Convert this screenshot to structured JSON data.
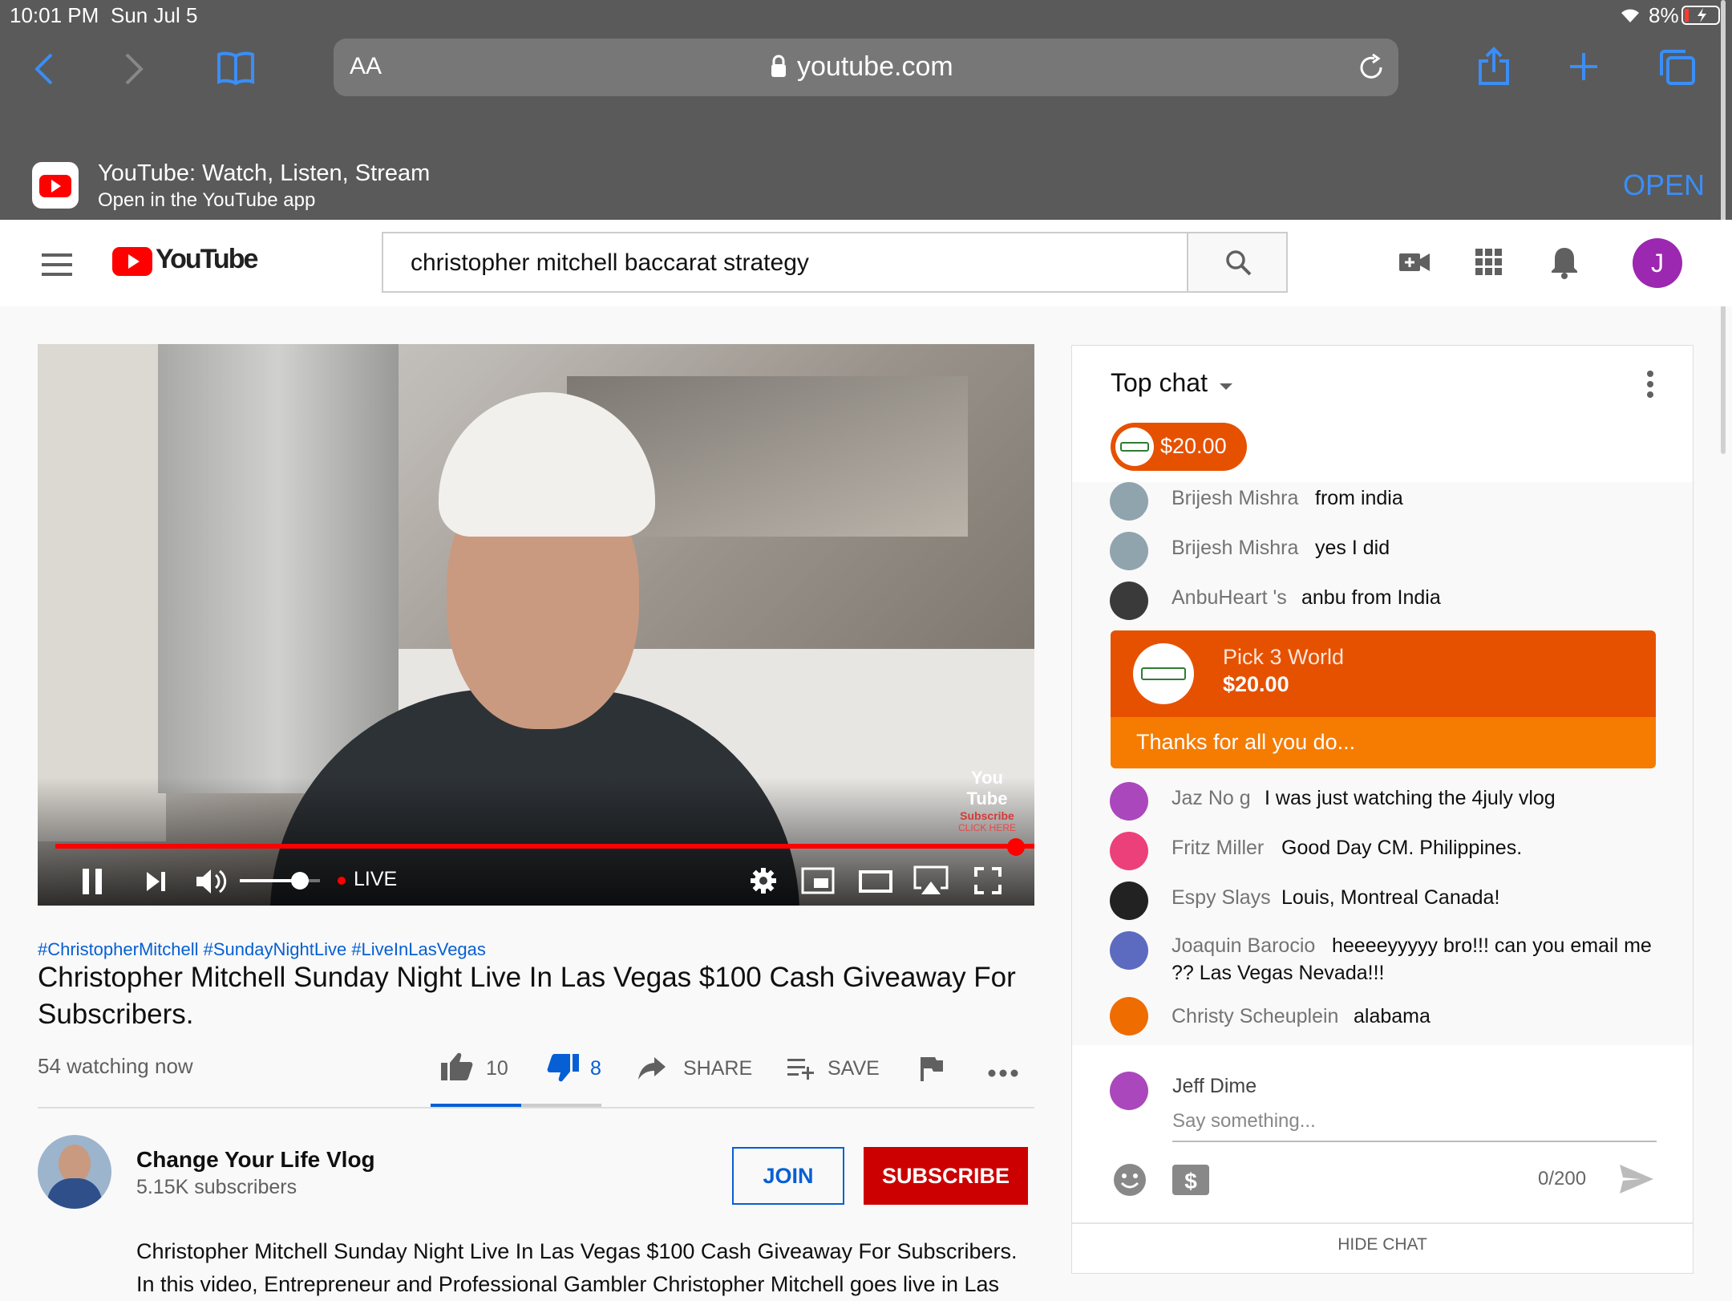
{
  "status_bar": {
    "time": "10:01 PM",
    "date": "Sun Jul 5",
    "battery": "8%"
  },
  "safari": {
    "text_size_label": "AA",
    "url": "youtube.com"
  },
  "app_banner": {
    "title": "YouTube: Watch, Listen, Stream",
    "subtitle": "Open in the YouTube app",
    "open_label": "OPEN"
  },
  "yt_header": {
    "logo_text": "YouTube",
    "search_query": "christopher mitchell baccarat strategy",
    "avatar_letter": "J"
  },
  "video": {
    "live_label": "LIVE",
    "watermark_line1": "You Tube",
    "watermark_line2": "Subscribe",
    "watermark_line3": "CLICK HERE",
    "progress": 1.0,
    "volume": 0.75
  },
  "video_info": {
    "hashtags": "#ChristopherMitchell #SundayNightLive #LiveInLasVegas",
    "title": "Christopher Mitchell Sunday Night Live In Las Vegas $100 Cash Giveaway For Subscribers.",
    "watching": "54 watching now",
    "likes": "10",
    "dislikes": "8",
    "share_label": "SHARE",
    "save_label": "SAVE"
  },
  "channel": {
    "name": "Change Your Life Vlog",
    "subscribers": "5.15K subscribers",
    "join_label": "JOIN",
    "subscribe_label": "SUBSCRIBE",
    "description": "Christopher Mitchell Sunday Night Live In Las Vegas $100 Cash Giveaway For Subscribers. In this video, Entrepreneur and Professional Gambler Christopher Mitchell goes live in Las"
  },
  "chat": {
    "header": "Top chat",
    "ticker_amount": "$20.00",
    "messages": [
      {
        "author": "Brijesh Mishra",
        "text": "from india",
        "color": "#90a4ae"
      },
      {
        "author": "Brijesh Mishra",
        "text": "yes I did",
        "color": "#90a4ae"
      },
      {
        "author": "AnbuHeart 's",
        "text": "anbu from India",
        "color": "#3a3a3a"
      }
    ],
    "superchat": {
      "author": "Pick 3 World",
      "amount": "$20.00",
      "text": "Thanks for all you do..."
    },
    "messages2": [
      {
        "author": "Jaz No g",
        "text": "I was just watching the 4july vlog",
        "color": "#ab47bc"
      },
      {
        "author": "Fritz Miller",
        "text": "Good Day CM. Philippines.",
        "color": "#ec407a"
      },
      {
        "author": "Espy Slays",
        "text": "Louis, Montreal Canada!",
        "color": "#222222"
      },
      {
        "author": "Joaquin Barocio",
        "text": "heeeeyyyyy bro!!! can you email me",
        "text2": "?? Las Vegas Nevada!!!",
        "color": "#5c6bc0"
      },
      {
        "author": "Christy Scheuplein",
        "text": "alabama",
        "color": "#ef6c00"
      }
    ],
    "input_user": "Jeff Dime",
    "input_placeholder": "Say something...",
    "char_count": "0/200",
    "hide_chat": "HIDE CHAT"
  }
}
